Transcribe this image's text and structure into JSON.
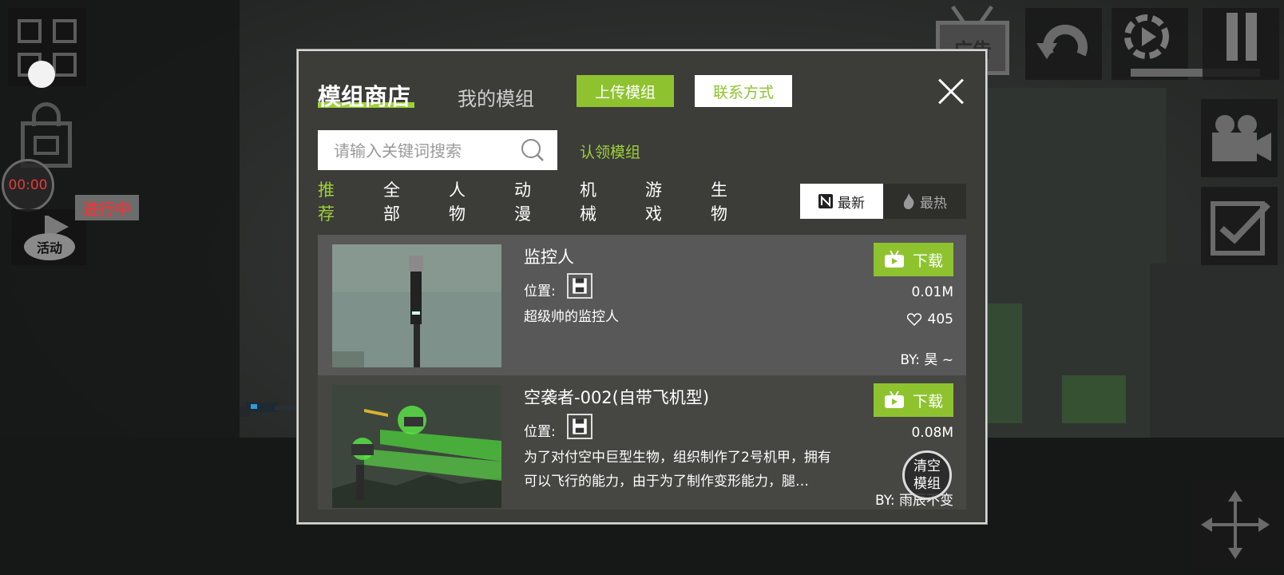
{
  "hud": {
    "timer": "00:00",
    "status": "进行中",
    "activity_label": "活动",
    "ad_label": "广告",
    "clear_mods": [
      "清空",
      "模组"
    ]
  },
  "modal": {
    "tab_store": "模组商店",
    "tab_mine": "我的模组",
    "upload_button": "上传模组",
    "contact_button": "联系方式",
    "search_placeholder": "请输入关键词搜索",
    "claim_link": "认领模组",
    "categories": [
      "推荐",
      "全部",
      "人物",
      "动漫",
      "机械",
      "游戏",
      "生物"
    ],
    "active_category": "推荐",
    "sort_newest": "最新",
    "sort_hottest": "最热",
    "location_label": "位置:",
    "download_label": "下载",
    "colors": {
      "accent": "#8ec32f",
      "accent_text": "#9dd039",
      "timer_red": "#e23b3b"
    },
    "items": [
      {
        "title": "监控人",
        "description": "超级帅的监控人",
        "size": "0.01M",
        "likes": "405",
        "author": "BY:  昊 ~"
      },
      {
        "title": "空袭者-002(自带飞机型)",
        "description": "为了对付空中巨型生物，组织制作了2号机甲，拥有可以飞行的能力，由于为了制作变形能力，腿…",
        "size": "0.08M",
        "likes": "",
        "author": "BY:  雨辰不变"
      }
    ]
  }
}
